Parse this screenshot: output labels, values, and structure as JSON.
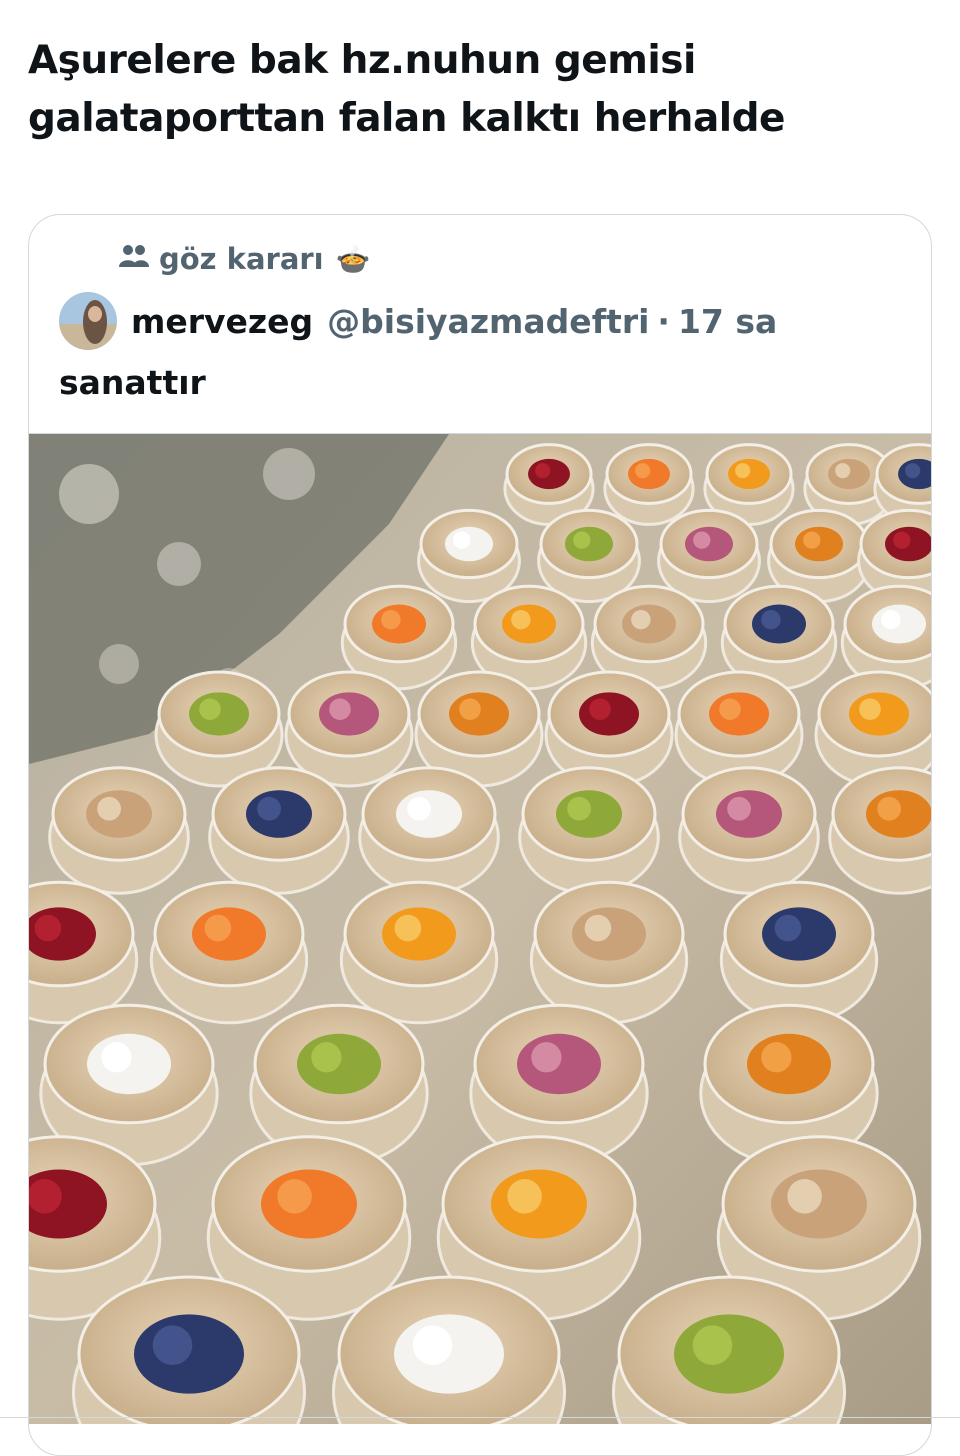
{
  "tweet": {
    "text_line1": "Aşurelere bak hz.nuhun gemisi",
    "text_line2": "galataporttan falan kalktı herhalde"
  },
  "quote": {
    "community_icon": "people-icon",
    "community_name": "göz kararı",
    "community_emoji": "🍲",
    "author_display_name": "mervezeg",
    "author_handle": "@bisiyazmadeftri",
    "separator": "·",
    "timestamp": "17 sa",
    "text": "sanattır",
    "media": {
      "description_icon": "photo-icon",
      "bowls": [
        {
          "topping": "red-flower"
        },
        {
          "topping": "orange-flower"
        },
        {
          "topping": "orange-slice"
        },
        {
          "topping": "nuts"
        },
        {
          "topping": "blueberries"
        },
        {
          "topping": "coconut"
        },
        {
          "topping": "pistachio"
        },
        {
          "topping": "rose-buds"
        },
        {
          "topping": "apricot"
        }
      ]
    }
  },
  "colors": {
    "text_primary": "#0f1419",
    "text_secondary": "#536471",
    "border": "#cfd9de"
  }
}
